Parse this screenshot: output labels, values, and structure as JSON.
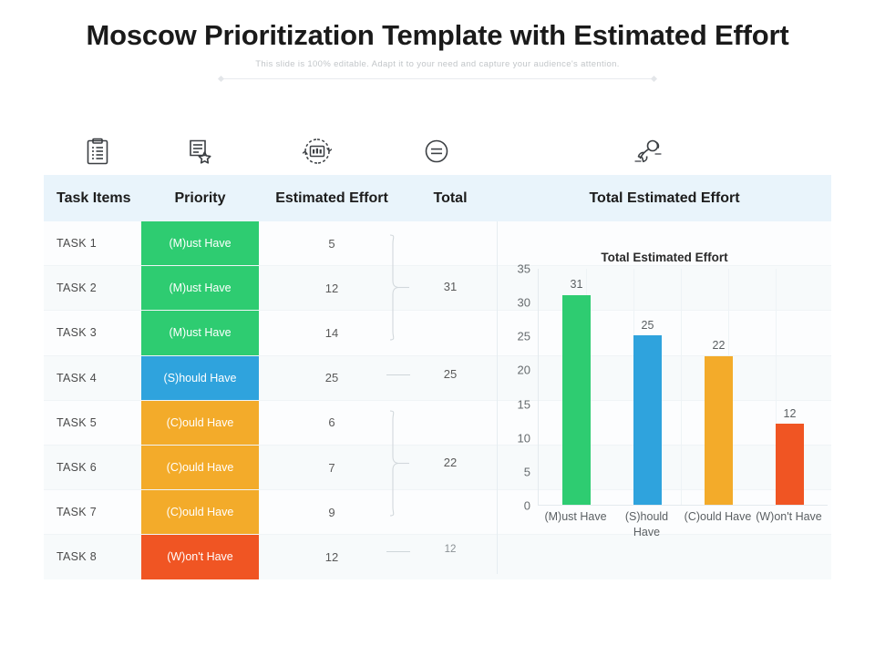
{
  "header": {
    "title": "Moscow Prioritization Template with Estimated Effort",
    "subtitle": "This slide is 100% editable. Adapt it to your need and capture your audience's attention."
  },
  "icons": [
    {
      "name": "clipboard-icon"
    },
    {
      "name": "document-star-icon"
    },
    {
      "name": "refresh-chart-icon"
    },
    {
      "name": "equals-circle-icon"
    },
    {
      "name": "rocket-icon"
    }
  ],
  "table": {
    "columns": [
      {
        "label": "Task Items"
      },
      {
        "label": "Priority"
      },
      {
        "label": "Estimated Effort"
      },
      {
        "label": "Total"
      },
      {
        "label": "Total Estimated Effort"
      }
    ],
    "rows": [
      {
        "task": "TASK 1",
        "priority": "(M)ust Have",
        "color": "#2ecc71",
        "effort": "5"
      },
      {
        "task": "TASK 2",
        "priority": "(M)ust Have",
        "color": "#2ecc71",
        "effort": "12"
      },
      {
        "task": "TASK 3",
        "priority": "(M)ust Have",
        "color": "#2ecc71",
        "effort": "14"
      },
      {
        "task": "TASK 4",
        "priority": "(S)hould Have",
        "color": "#2fa3dd",
        "effort": "25"
      },
      {
        "task": "TASK 5",
        "priority": "(C)ould Have",
        "color": "#f3ab2a",
        "effort": "6"
      },
      {
        "task": "TASK 6",
        "priority": "(C)ould Have",
        "color": "#f3ab2a",
        "effort": "7"
      },
      {
        "task": "TASK 7",
        "priority": "(C)ould Have",
        "color": "#f3ab2a",
        "effort": "9"
      },
      {
        "task": "TASK 8",
        "priority": "(W)on't Have",
        "color": "#f05523",
        "effort": "12"
      }
    ],
    "groups": [
      {
        "rows": [
          0,
          1,
          2
        ],
        "total": "31",
        "type": "brace"
      },
      {
        "rows": [
          3
        ],
        "total": "25",
        "type": "dash"
      },
      {
        "rows": [
          4,
          5,
          6
        ],
        "total": "22",
        "type": "brace"
      },
      {
        "rows": [
          7
        ],
        "total": "12",
        "type": "dash"
      }
    ]
  },
  "chart_data": {
    "type": "bar",
    "title": "Total Estimated Effort",
    "xlabel": "",
    "ylabel": "",
    "categories": [
      "(M)ust Have",
      "(S)hould Have",
      "(C)ould Have",
      "(W)on't Have"
    ],
    "values": [
      31,
      25,
      22,
      12
    ],
    "colors": [
      "#2ecc71",
      "#2fa3dd",
      "#f3ab2a",
      "#f05523"
    ],
    "ylim": [
      0,
      35
    ],
    "yticks": [
      0,
      5,
      10,
      15,
      20,
      25,
      30,
      35
    ],
    "grid": true,
    "legend": "none",
    "data_labels": [
      "31",
      "25",
      "22",
      "12"
    ]
  },
  "colors": {
    "must": "#2ecc71",
    "should": "#2fa3dd",
    "could": "#f3ab2a",
    "wont": "#f05523",
    "header_bg": "#e9f4fb"
  }
}
